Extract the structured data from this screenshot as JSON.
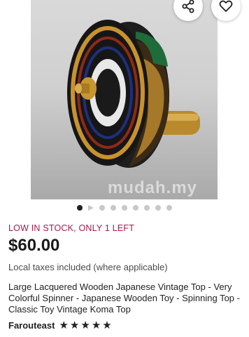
{
  "listing": {
    "stock_notice": "LOW IN STOCK, ONLY 1 LEFT",
    "price": "$60.00",
    "taxes_note": "Local taxes included (where applicable)",
    "title": "Large Lacquered Wooden Japanese Vintage Top - Very Colorful Spinner - Japanese Wooden Toy - Spinning Top - Classic Toy Vintage Koma Top",
    "seller": "Farouteast",
    "rating_stars": 5,
    "rating_max": 5
  },
  "gallery": {
    "image_count": 9,
    "current_index": 1,
    "video_index": 2,
    "watermark": "mudah.my"
  },
  "actions": {
    "share_icon": "share-icon",
    "favorite_icon": "heart-icon"
  },
  "colors": {
    "stock_notice": "#a61a48",
    "active_dot": "#222222",
    "inactive_dot": "#c8c8c8"
  }
}
